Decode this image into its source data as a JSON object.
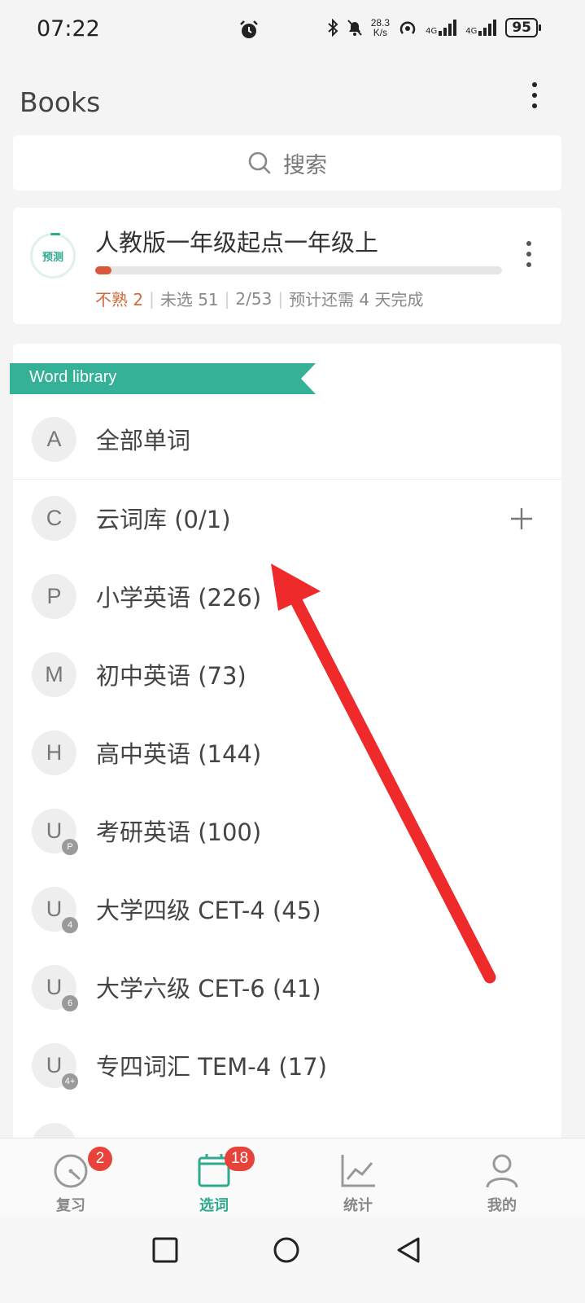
{
  "status_bar": {
    "time": "07:22",
    "net_speed_value": "28.3",
    "net_speed_unit": "K/s",
    "signal_1_label": "4G",
    "signal_2_label": "4G",
    "battery": "95"
  },
  "header": {
    "title": "Books"
  },
  "search": {
    "label": "搜索"
  },
  "current_book": {
    "badge": "预测",
    "title": "人教版一年级起点一年级上",
    "progress_fraction": 0.04,
    "stats": {
      "unfamiliar": "不熟 2",
      "unselected": "未选 51",
      "count": "2/53",
      "eta": "预计还需 4 天完成"
    }
  },
  "library": {
    "ribbon_label": "Word library",
    "items": [
      {
        "letter": "A",
        "sub": "",
        "label": "全部单词"
      },
      {
        "letter": "C",
        "sub": "",
        "label": "云词库 (0/1)"
      },
      {
        "letter": "P",
        "sub": "",
        "label": "小学英语 (226)"
      },
      {
        "letter": "M",
        "sub": "",
        "label": "初中英语 (73)"
      },
      {
        "letter": "H",
        "sub": "",
        "label": "高中英语 (144)"
      },
      {
        "letter": "U",
        "sub": "P",
        "label": "考研英语 (100)"
      },
      {
        "letter": "U",
        "sub": "4",
        "label": "大学四级 CET-4 (45)"
      },
      {
        "letter": "U",
        "sub": "6",
        "label": "大学六级 CET-6 (41)"
      },
      {
        "letter": "U",
        "sub": "4+",
        "label": "专四词汇 TEM-4 (17)"
      }
    ]
  },
  "bottom_nav": {
    "items": [
      {
        "label": "复习",
        "badge": "2",
        "icon": "review-gauge-icon"
      },
      {
        "label": "选词",
        "badge": "18",
        "icon": "book-select-icon"
      },
      {
        "label": "统计",
        "badge": "",
        "icon": "stats-chart-icon"
      },
      {
        "label": "我的",
        "badge": "",
        "icon": "profile-icon"
      }
    ],
    "active_index": 1
  },
  "colors": {
    "accent": "#2faa8f",
    "badge_red": "#e8433a",
    "unfamiliar": "#d36a3e",
    "annotation_arrow": "#ee2a2a"
  }
}
